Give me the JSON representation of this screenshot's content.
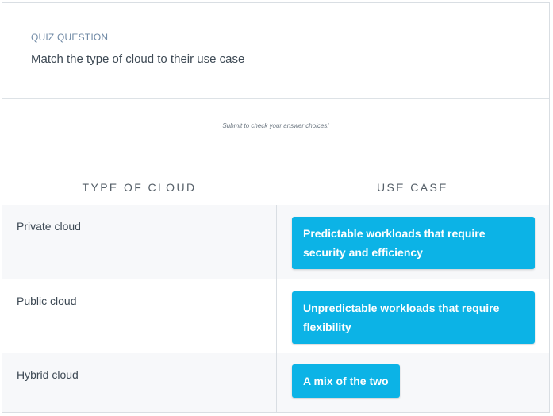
{
  "quiz": {
    "label": "QUIZ QUESTION",
    "question": "Match the type of cloud to their use case",
    "hint": "Submit to check your answer choices!"
  },
  "columns": {
    "left": "TYPE OF CLOUD",
    "right": "USE CASE"
  },
  "rows": [
    {
      "type": "Private cloud",
      "use_case": "Predictable workloads that require security and efficiency"
    },
    {
      "type": "Public cloud",
      "use_case": "Unpredictable workloads that require flexibility"
    },
    {
      "type": "Hybrid cloud",
      "use_case": "A mix of the two"
    }
  ],
  "colors": {
    "chip": "#0cb3e6",
    "row_shade": "#f7f8fa",
    "label": "#6e88a4"
  }
}
